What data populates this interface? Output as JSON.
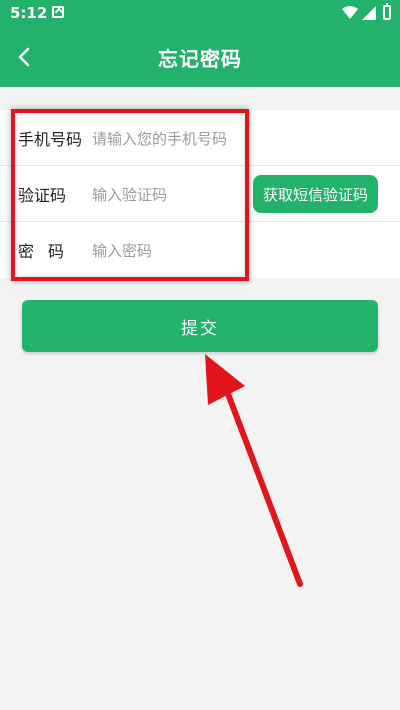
{
  "status_bar": {
    "time": "5:12",
    "icons": [
      "notification-icon",
      "wifi-icon",
      "signal-icon",
      "battery-icon"
    ]
  },
  "app_bar": {
    "title": "忘记密码",
    "back_icon": "back-arrow-icon"
  },
  "form": {
    "phone": {
      "label": "手机号码",
      "placeholder": "请输入您的手机号码"
    },
    "code": {
      "label": "验证码",
      "placeholder": "输入验证码",
      "sms_button": "获取短信验证码"
    },
    "password": {
      "label": "密码",
      "placeholder": "输入密码"
    }
  },
  "submit": {
    "label": "提交"
  },
  "colors": {
    "primary": "#23b26b",
    "annotation": "#e3151c",
    "background": "#f3f3f3"
  }
}
